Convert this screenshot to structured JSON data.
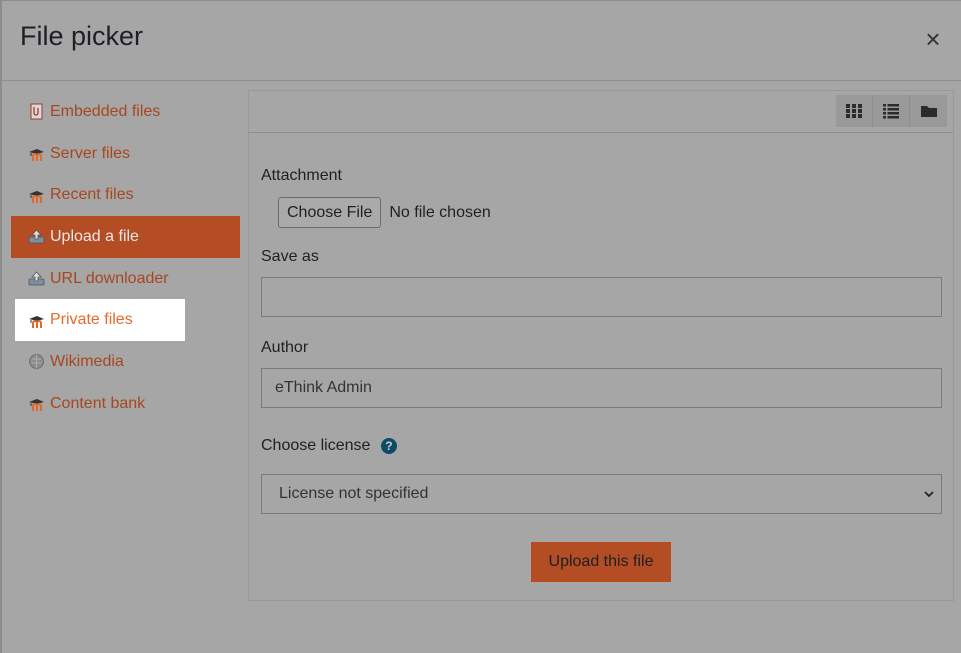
{
  "dialog": {
    "title": "File picker",
    "close_symbol": "×"
  },
  "sidebar": {
    "items": [
      {
        "label": "Embedded files",
        "icon": "embedded-files-icon"
      },
      {
        "label": "Server files",
        "icon": "moodle-icon"
      },
      {
        "label": "Recent files",
        "icon": "moodle-icon"
      },
      {
        "label": "Upload a file",
        "icon": "upload-icon",
        "state": "active"
      },
      {
        "label": "URL downloader",
        "icon": "url-downloader-icon"
      },
      {
        "label": "Private files",
        "icon": "moodle-icon",
        "state": "highlighted"
      },
      {
        "label": "Wikimedia",
        "icon": "wikimedia-globe-icon"
      },
      {
        "label": "Content bank",
        "icon": "moodle-icon"
      }
    ]
  },
  "toolbar": {
    "views": [
      "icons-view-icon",
      "list-view-icon",
      "tree-view-icon"
    ]
  },
  "form": {
    "attachment_label": "Attachment",
    "choose_file_label": "Choose File",
    "no_file_text": "No file chosen",
    "save_as_label": "Save as",
    "save_as_value": "",
    "author_label": "Author",
    "author_value": "eThink Admin",
    "license_label": "Choose license",
    "license_help": "?",
    "license_value": "License not specified",
    "upload_button": "Upload this file"
  },
  "colors": {
    "accent": "#b44c24",
    "link": "#a6471f",
    "help": "#0f4a66"
  }
}
